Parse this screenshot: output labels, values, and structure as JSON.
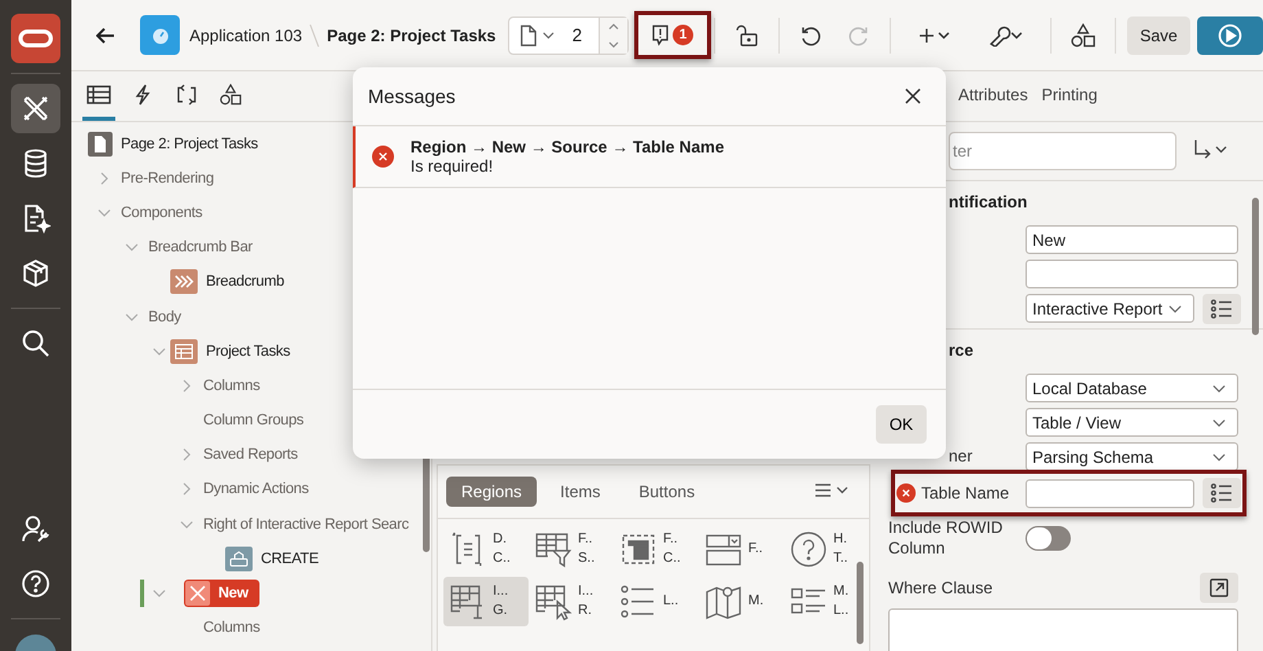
{
  "rail": {
    "top_groups": [
      [
        {
          "kind": "logo",
          "selected": false
        }
      ],
      [
        {
          "kind": "builder",
          "selected": true
        },
        {
          "kind": "database",
          "selected": false
        },
        {
          "kind": "sql",
          "selected": false
        },
        {
          "kind": "package",
          "selected": false
        }
      ],
      [
        {
          "kind": "search",
          "selected": false
        }
      ]
    ],
    "bottom_groups": [
      [
        {
          "kind": "admin",
          "selected": false
        },
        {
          "kind": "help",
          "selected": false
        }
      ],
      [
        {
          "kind": "avatar",
          "selected": false
        }
      ]
    ]
  },
  "header": {
    "app": "Application 103",
    "page": "Page 2: Project Tasks",
    "page_number": "2",
    "messages": {
      "count": "1",
      "highlighted": true
    },
    "redo_disabled": true,
    "save": "Save"
  },
  "left_tabs": [
    {
      "kind": "rendering",
      "selected": true
    },
    {
      "kind": "dynamic",
      "selected": false
    },
    {
      "kind": "processing",
      "selected": false
    },
    {
      "kind": "shared",
      "selected": false
    }
  ],
  "tree": {
    "items": [
      {
        "label": "Page 2: Project Tasks",
        "kind": "page",
        "selected": false,
        "children": [
          {
            "label": "Pre-Rendering",
            "selected": false,
            "expanded": false
          },
          {
            "label": "Components",
            "selected": false,
            "expanded": true,
            "children": [
              {
                "label": "Breadcrumb Bar",
                "selected": false,
                "expanded": true,
                "children": [
                  {
                    "label": "Breadcrumb",
                    "kind": "breadcrumb",
                    "selected": false
                  }
                ]
              },
              {
                "label": "Body",
                "selected": false,
                "expanded": true,
                "children": [
                  {
                    "label": "Project Tasks",
                    "kind": "report",
                    "selected": false,
                    "expanded": true,
                    "children": [
                      {
                        "label": "Columns",
                        "selected": false,
                        "expanded": false
                      },
                      {
                        "label": "Column Groups",
                        "selected": false
                      },
                      {
                        "label": "Saved Reports",
                        "selected": false,
                        "expanded": false
                      },
                      {
                        "label": "Dynamic Actions",
                        "selected": false,
                        "expanded": false
                      },
                      {
                        "label": "Right of Interactive Report Searc",
                        "selected": false,
                        "expanded": true,
                        "children": [
                          {
                            "label": "CREATE",
                            "kind": "button",
                            "selected": false
                          }
                        ]
                      }
                    ]
                  },
                  {
                    "label": "New",
                    "kind": "error",
                    "selected": true,
                    "expanded": true,
                    "children": [
                      {
                        "label": "Columns",
                        "selected": false
                      }
                    ]
                  }
                ]
              }
            ]
          }
        ]
      }
    ]
  },
  "gallery": {
    "tabs": [
      {
        "label": "Regions",
        "selected": true
      },
      {
        "label": "Items",
        "selected": false
      },
      {
        "label": "Buttons",
        "selected": false
      }
    ],
    "items": [
      {
        "kind": "dynamic",
        "lines": [
          "D.",
          "C.."
        ],
        "selected": false
      },
      {
        "kind": "faceted",
        "lines": [
          "F..",
          "S.."
        ],
        "selected": false
      },
      {
        "kind": "form",
        "lines": [
          "F..",
          "C.."
        ],
        "selected": false
      },
      {
        "kind": "select",
        "lines": [
          "F.."
        ],
        "selected": false
      },
      {
        "kind": "help",
        "lines": [
          "H.",
          "T.."
        ],
        "selected": false
      },
      {
        "kind": "grid",
        "lines": [
          "I...",
          "G."
        ],
        "selected": true
      },
      {
        "kind": "report",
        "lines": [
          "I...",
          "R."
        ],
        "selected": false
      },
      {
        "kind": "list",
        "lines": [
          "L.."
        ],
        "selected": false
      },
      {
        "kind": "map",
        "lines": [
          "M."
        ],
        "selected": false
      },
      {
        "kind": "media",
        "lines": [
          "M.",
          "L.."
        ],
        "selected": false
      }
    ]
  },
  "properties": {
    "tabs": [
      {
        "label": "Attributes",
        "selected": false
      },
      {
        "label": "Printing",
        "selected": false
      }
    ],
    "filter_placeholder": "ter",
    "groups": [
      {
        "heading": "ntification",
        "cut": true,
        "rows": [
          {
            "kind": "text",
            "value": "New"
          },
          {
            "kind": "text"
          },
          {
            "kind": "select",
            "value": "Interactive Report",
            "picker": true
          }
        ]
      },
      {
        "heading": "rce",
        "cut": true,
        "rows": [
          {
            "kind": "select",
            "value": "Local Database"
          },
          {
            "kind": "select",
            "value": "Table / View"
          },
          {
            "kind": "select",
            "label": "ner",
            "label_cut": true,
            "value": "Parsing Schema"
          },
          {
            "kind": "text",
            "label": "Table Name",
            "error": true,
            "highlighted": true,
            "picker": true
          },
          {
            "kind": "switch",
            "label": "Include ROWID Column",
            "on": false
          },
          {
            "kind": "code",
            "label": "Where Clause"
          }
        ]
      }
    ]
  },
  "dialog": {
    "title": "Messages",
    "messages": [
      {
        "path": "Region → New → Source → Table Name",
        "text": "Is required!"
      }
    ],
    "ok": "OK"
  }
}
